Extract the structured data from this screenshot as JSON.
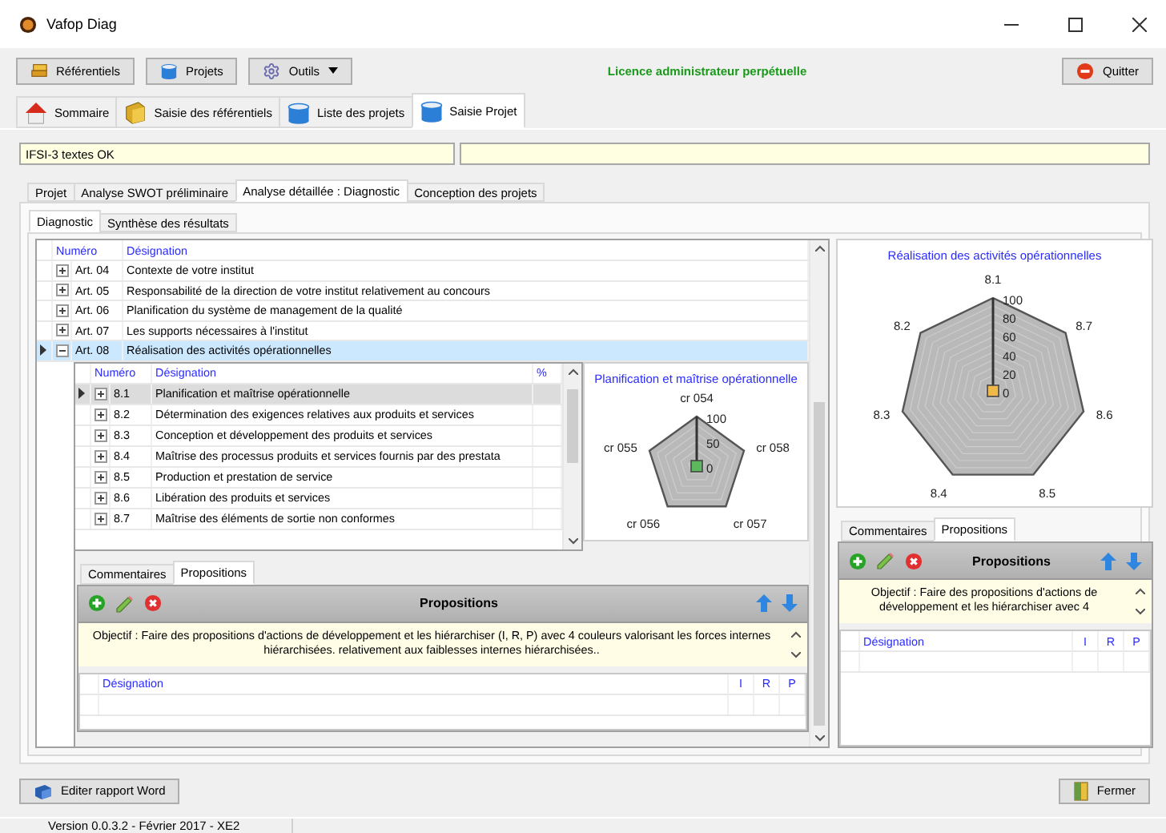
{
  "window": {
    "title": "Vafop Diag"
  },
  "toolbar": {
    "buttons": [
      {
        "label": "Référentiels",
        "dropdown": false
      },
      {
        "label": "Projets",
        "dropdown": false
      },
      {
        "label": "Outils",
        "dropdown": true
      }
    ],
    "license": "Licence administrateur perpétuelle",
    "quit": "Quitter"
  },
  "main_tabs": [
    {
      "label": "Sommaire",
      "selected": false
    },
    {
      "label": "Saisie des référentiels",
      "selected": false
    },
    {
      "label": "Liste des projets",
      "selected": false
    },
    {
      "label": "Saisie Projet",
      "selected": true
    }
  ],
  "project_name": "IFSI-3 textes OK",
  "analysis_tabs": [
    {
      "label": "Projet",
      "selected": false
    },
    {
      "label": "Analyse SWOT préliminaire",
      "selected": false
    },
    {
      "label": "Analyse détaillée : Diagnostic",
      "selected": true
    },
    {
      "label": "Conception des projets",
      "selected": false
    }
  ],
  "diagnostic_tabs": [
    {
      "label": "Diagnostic",
      "selected": true
    },
    {
      "label": "Synthèse des résultats",
      "selected": false
    }
  ],
  "articles": {
    "columns": [
      "Numéro",
      "Désignation"
    ],
    "rows": [
      {
        "number": "Art. 04",
        "designation": "Contexte de votre institut",
        "expanded": false,
        "selected": false
      },
      {
        "number": "Art. 05",
        "designation": "Responsabilité de la direction de votre institut relativement au concours",
        "expanded": false,
        "selected": false
      },
      {
        "number": "Art. 06",
        "designation": "Planification du système de management de la qualité",
        "expanded": false,
        "selected": false
      },
      {
        "number": "Art. 07",
        "designation": "Les supports nécessaires à l'institut",
        "expanded": false,
        "selected": false
      },
      {
        "number": "Art. 08",
        "designation": "Réalisation des activités opérationnelles",
        "expanded": true,
        "selected": true
      }
    ]
  },
  "sections": {
    "columns": [
      "Numéro",
      "Désignation",
      "%"
    ],
    "rows": [
      {
        "number": "8.1",
        "designation": "Planification et maîtrise opérationnelle",
        "selected": true
      },
      {
        "number": "8.2",
        "designation": "Détermination des exigences relatives aux produits et services",
        "selected": false
      },
      {
        "number": "8.3",
        "designation": "Conception et développement des produits et services",
        "selected": false
      },
      {
        "number": "8.4",
        "designation": "Maîtrise des processus produits et services fournis par des prestata",
        "selected": false
      },
      {
        "number": "8.5",
        "designation": "Production et prestation de service",
        "selected": false
      },
      {
        "number": "8.6",
        "designation": "Libération des produits et services",
        "selected": false
      },
      {
        "number": "8.7",
        "designation": "Maîtrise des éléments de sortie non conformes",
        "selected": false
      }
    ]
  },
  "section_chart": {
    "title": "Planification et maîtrise opérationnelle",
    "axes": [
      "cr 054",
      "cr 058",
      "cr 057",
      "cr 056",
      "cr 055"
    ],
    "ticks": [
      "100",
      "50",
      "0"
    ],
    "color": "#5cb85c"
  },
  "section_notes": {
    "tabs": [
      {
        "label": "Commentaires",
        "selected": false
      },
      {
        "label": "Propositions",
        "selected": true
      }
    ],
    "title": "Propositions",
    "objective": "Objectif : Faire des propositions d'actions de développement et les hiérarchiser (I, R, P) avec 4 couleurs valorisant les forces internes hiérarchisées. relativement aux faiblesses internes hiérarchisées..",
    "columns": [
      "Désignation",
      "I",
      "R",
      "P"
    ]
  },
  "article_chart": {
    "title": "Réalisation des activités opérationnelles",
    "axes": [
      "8.1",
      "8.7",
      "8.6",
      "8.5",
      "8.4",
      "8.3",
      "8.2"
    ],
    "ticks": [
      "100",
      "80",
      "60",
      "40",
      "20",
      "0"
    ],
    "color": "#f0b848"
  },
  "article_notes": {
    "tabs": [
      {
        "label": "Commentaires",
        "selected": false
      },
      {
        "label": "Propositions",
        "selected": true
      }
    ],
    "title": "Propositions",
    "objective": "Objectif : Faire des propositions d'actions de développement et les hiérarchiser avec 4",
    "columns": [
      "Désignation",
      "I",
      "R",
      "P"
    ]
  },
  "footer": {
    "report_button": "Editer rapport Word",
    "close_button": "Fermer",
    "version": "Version 0.0.3.2 - Février 2017 - XE2"
  }
}
